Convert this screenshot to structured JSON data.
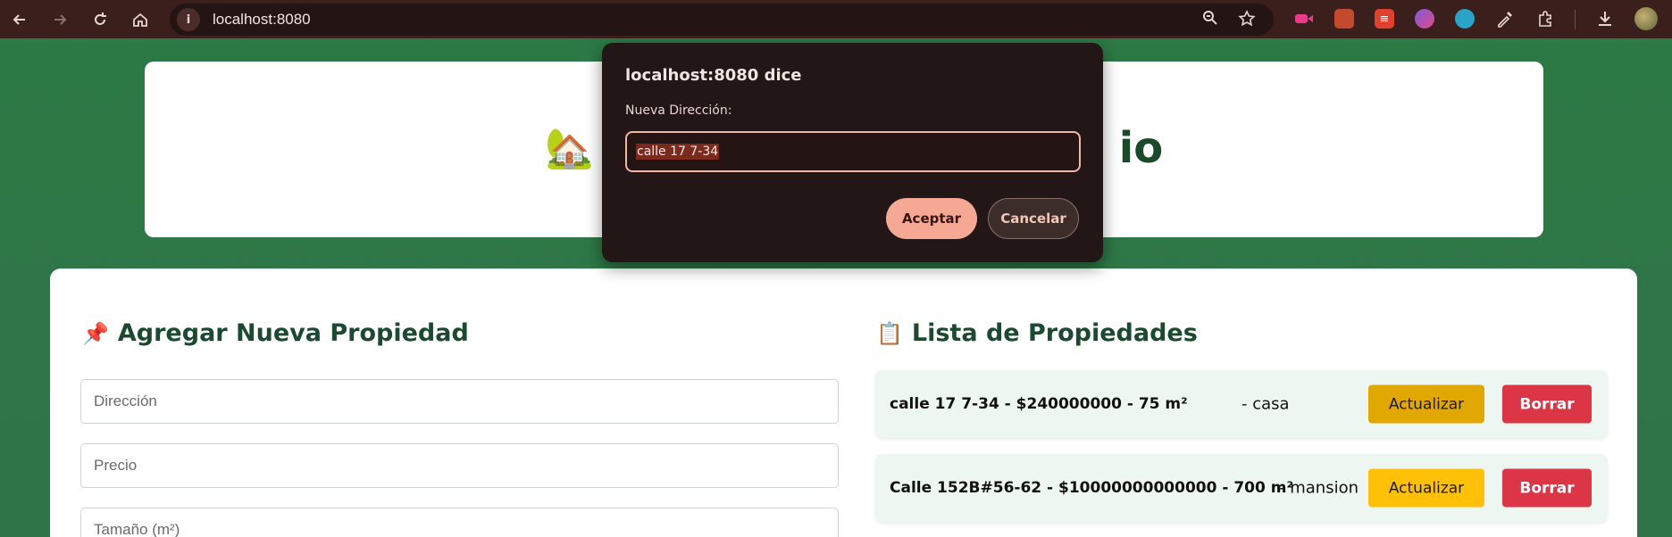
{
  "browser": {
    "url": "localhost:8080",
    "back_icon": "arrow-left-icon",
    "forward_icon": "arrow-right-icon",
    "reload_icon": "reload-icon",
    "home_icon": "home-icon"
  },
  "header": {
    "title_visible_end": "io",
    "icon": "house-icon"
  },
  "form": {
    "title": "Agregar Nueva Propiedad",
    "icon": "pushpin-icon",
    "fields": [
      {
        "placeholder": "Dirección",
        "value": ""
      },
      {
        "placeholder": "Precio",
        "value": ""
      },
      {
        "placeholder": "Tamaño (m²)",
        "value": ""
      }
    ]
  },
  "list": {
    "title": "Lista de Propiedades",
    "icon": "clipboard-icon",
    "items": [
      {
        "main": "calle 17 7-34 - $240000000 - 75 m²",
        "type": "- casa",
        "update_label": "Actualizar",
        "delete_label": "Borrar",
        "update_color": "#e0a800"
      },
      {
        "main": "Calle 152B#56-62 - $10000000000000 - 700 m²",
        "type": "- mansion",
        "update_label": "Actualizar",
        "delete_label": "Borrar",
        "update_color": "#ffc107"
      }
    ]
  },
  "dialog": {
    "title": "localhost:8080 dice",
    "message": "Nueva Dirección:",
    "input_value": "calle 17 7-34",
    "ok_label": "Aceptar",
    "cancel_label": "Cancelar"
  },
  "colors": {
    "background": "#2d7a45",
    "delete": "#dc3545",
    "heading": "#1c4a30"
  }
}
